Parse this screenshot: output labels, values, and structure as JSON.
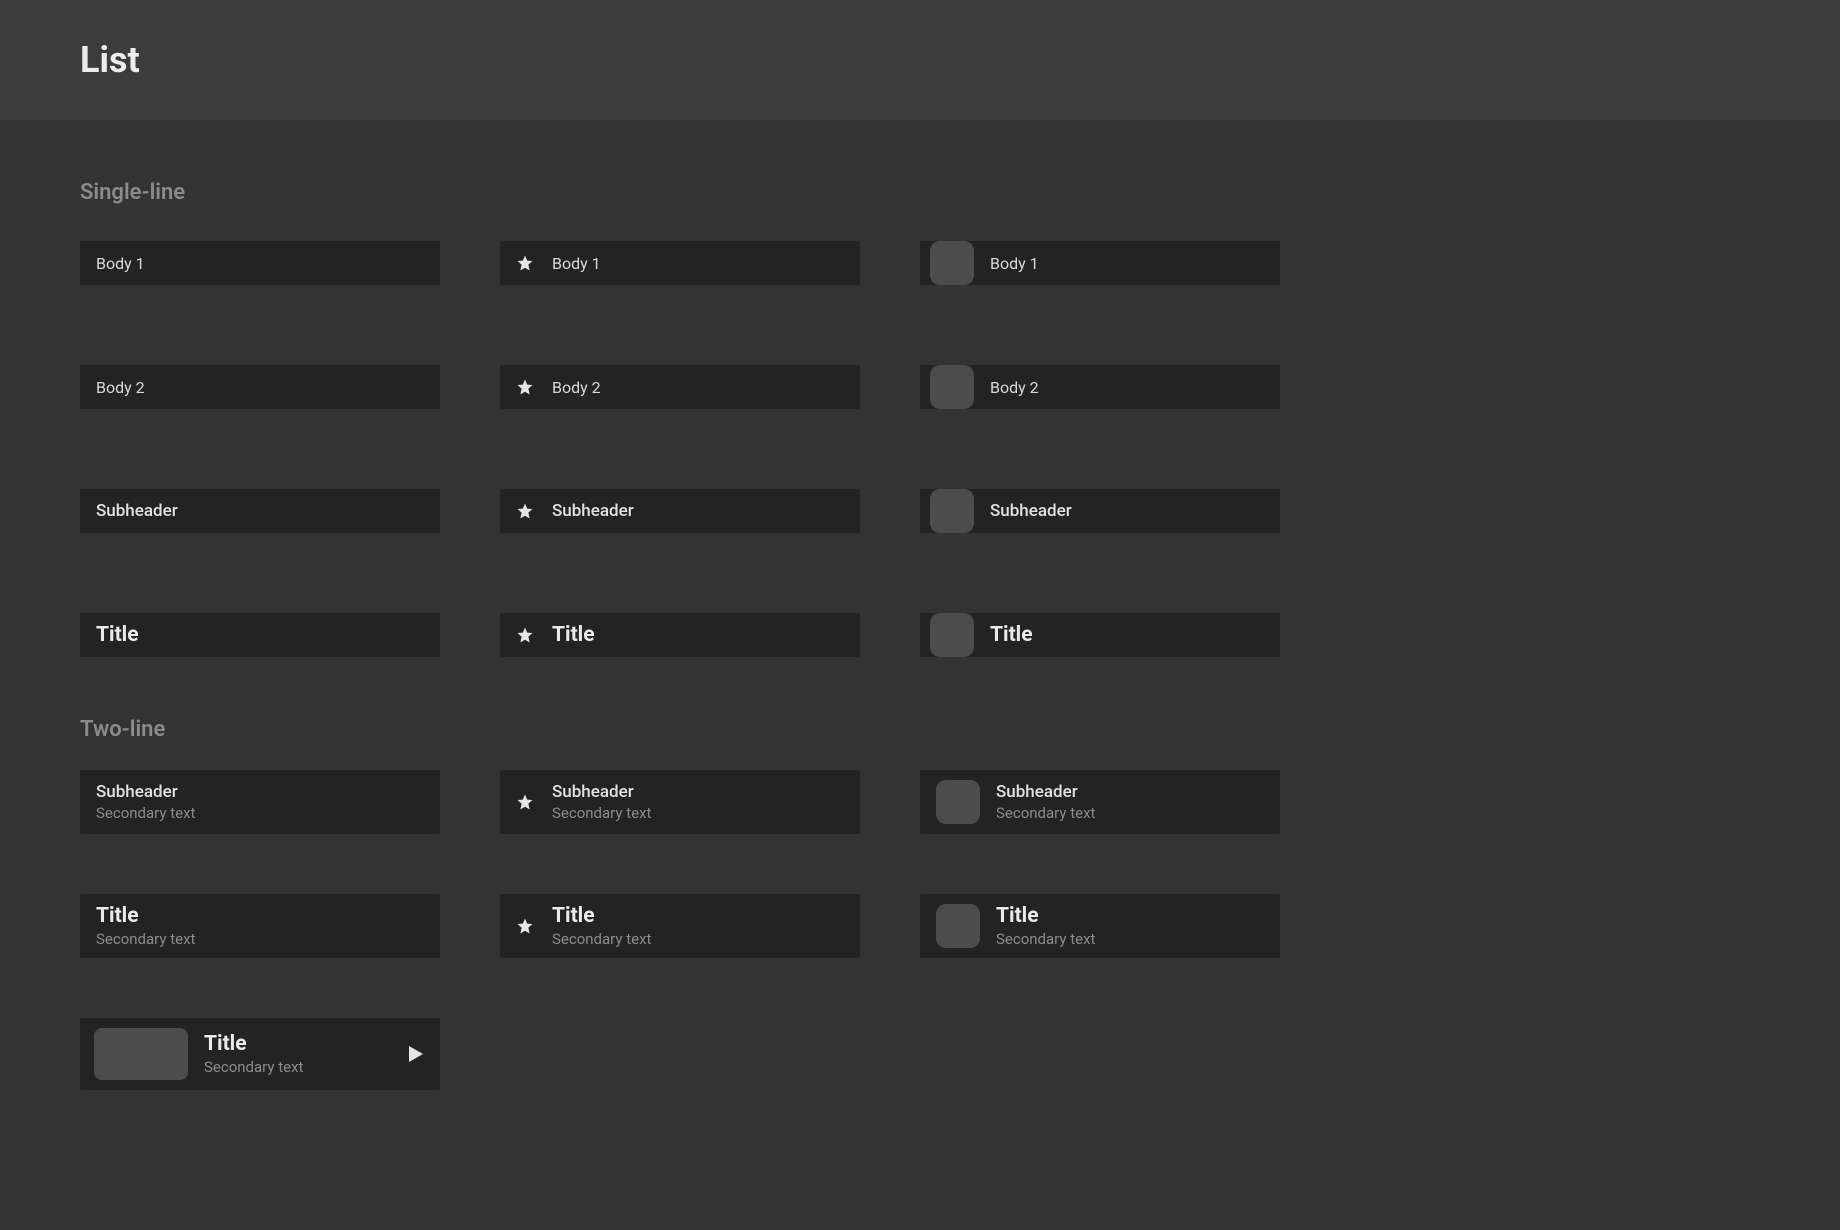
{
  "header": {
    "title": "List"
  },
  "sections": {
    "single": {
      "title": "Single-line"
    },
    "two": {
      "title": "Two-line"
    }
  },
  "items": {
    "body1": "Body 1",
    "body2": "Body 2",
    "subheader": "Subheader",
    "title": "Title",
    "secondary": "Secondary text"
  }
}
